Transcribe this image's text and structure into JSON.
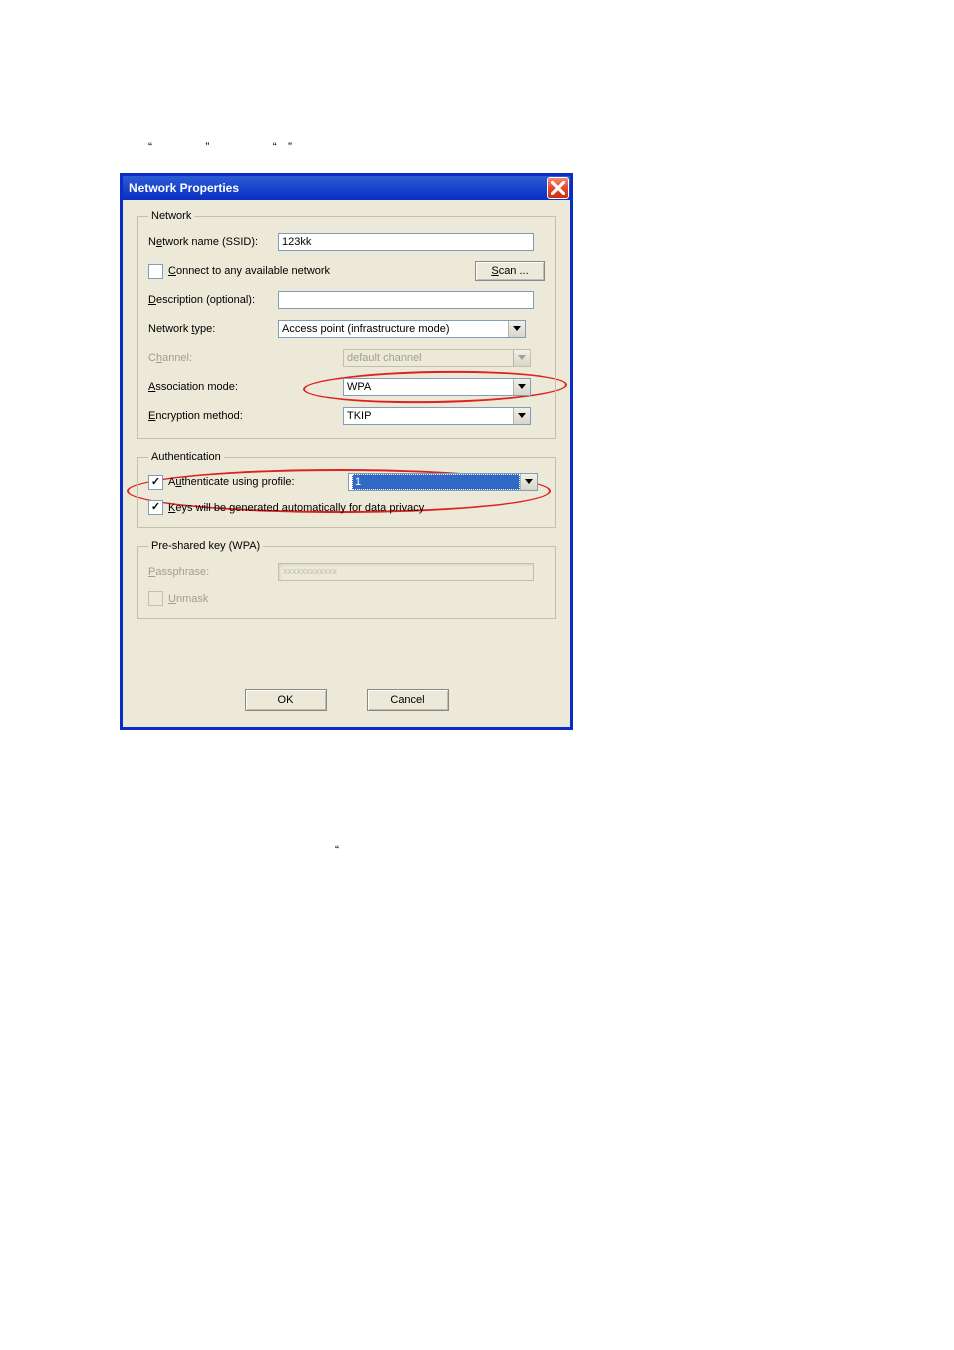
{
  "decorations": {
    "openq": "“",
    "closeq": "”"
  },
  "dialog": {
    "title": "Network Properties"
  },
  "network": {
    "legend": "Network",
    "ssid_label_pre": "N",
    "ssid_label_u": "e",
    "ssid_label_post": "twork name (SSID):",
    "ssid_value": "123kk",
    "connect_any_pre": "",
    "connect_any_u": "C",
    "connect_any_post": "onnect to any available network",
    "scan_pre": "",
    "scan_u": "S",
    "scan_post": "can ...",
    "desc_pre": "",
    "desc_u": "D",
    "desc_post": "escription (optional):",
    "desc_value": "",
    "type_pre": "Network ",
    "type_u": "t",
    "type_post": "ype:",
    "type_value": "Access point (infrastructure mode)",
    "channel_pre": "C",
    "channel_u": "h",
    "channel_post": "annel:",
    "channel_value": "default channel",
    "assoc_pre": "",
    "assoc_u": "A",
    "assoc_post": "ssociation mode:",
    "assoc_value": "WPA",
    "enc_pre": "",
    "enc_u": "E",
    "enc_post": "ncryption method:",
    "enc_value": "TKIP"
  },
  "auth": {
    "legend": "Authentication",
    "auth_pre": "A",
    "auth_u": "u",
    "auth_post": "thenticate using profile:",
    "profile_value": "1",
    "keys_pre": "",
    "keys_u": "K",
    "keys_post": "eys will be generated automatically for data privacy"
  },
  "psk": {
    "legend": "Pre-shared key (WPA)",
    "pass_pre": "",
    "pass_u": "P",
    "pass_post": "assphrase:",
    "pass_value": "xxxxxxxxxxxx",
    "unmask_pre": "",
    "unmask_u": "U",
    "unmask_post": "nmask"
  },
  "buttons": {
    "ok": "OK",
    "cancel": "Cancel"
  }
}
